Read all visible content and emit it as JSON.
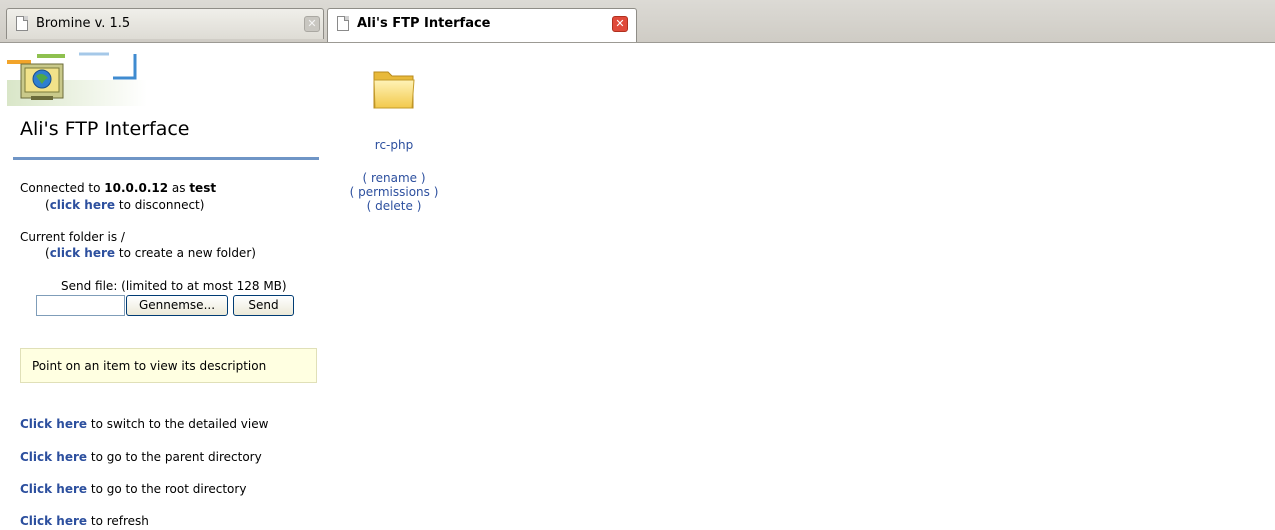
{
  "tabs": [
    {
      "label": "Bromine v. 1.5",
      "active": false
    },
    {
      "label": "Ali's FTP Interface",
      "active": true
    }
  ],
  "colors": {
    "link": "#2c4f9e",
    "rule": "#6f95c6",
    "description_bg": "#ffffe1",
    "close_active": "#e04a3a"
  },
  "sidebar": {
    "title": "Ali's FTP Interface",
    "connection": {
      "prefix": "Connected to ",
      "host": "10.0.0.12",
      "as_text": " as ",
      "user": "test",
      "disconnect_open": "(",
      "disconnect_link": "click here",
      "disconnect_suffix": " to disconnect)"
    },
    "folder": {
      "current": "Current folder is /",
      "newfolder_open": "(",
      "newfolder_link": "click here",
      "newfolder_suffix": " to create a new folder)"
    },
    "upload": {
      "label": "Send file: (limited to at most 128 MB)",
      "browse_label": "Gennemse...",
      "send_label": "Send"
    },
    "description": "Point on an item to view its description",
    "actions": [
      {
        "link": "Click here",
        "text": " to switch to the detailed view"
      },
      {
        "link": "Click here",
        "text": " to go to the parent directory"
      },
      {
        "link": "Click here",
        "text": " to go to the root directory"
      },
      {
        "link": "Click here",
        "text": " to refresh"
      }
    ]
  },
  "items": [
    {
      "name": "rc-php",
      "icon": "folder-icon",
      "actions": [
        "( rename )",
        "( permissions )",
        "( delete )"
      ]
    }
  ]
}
